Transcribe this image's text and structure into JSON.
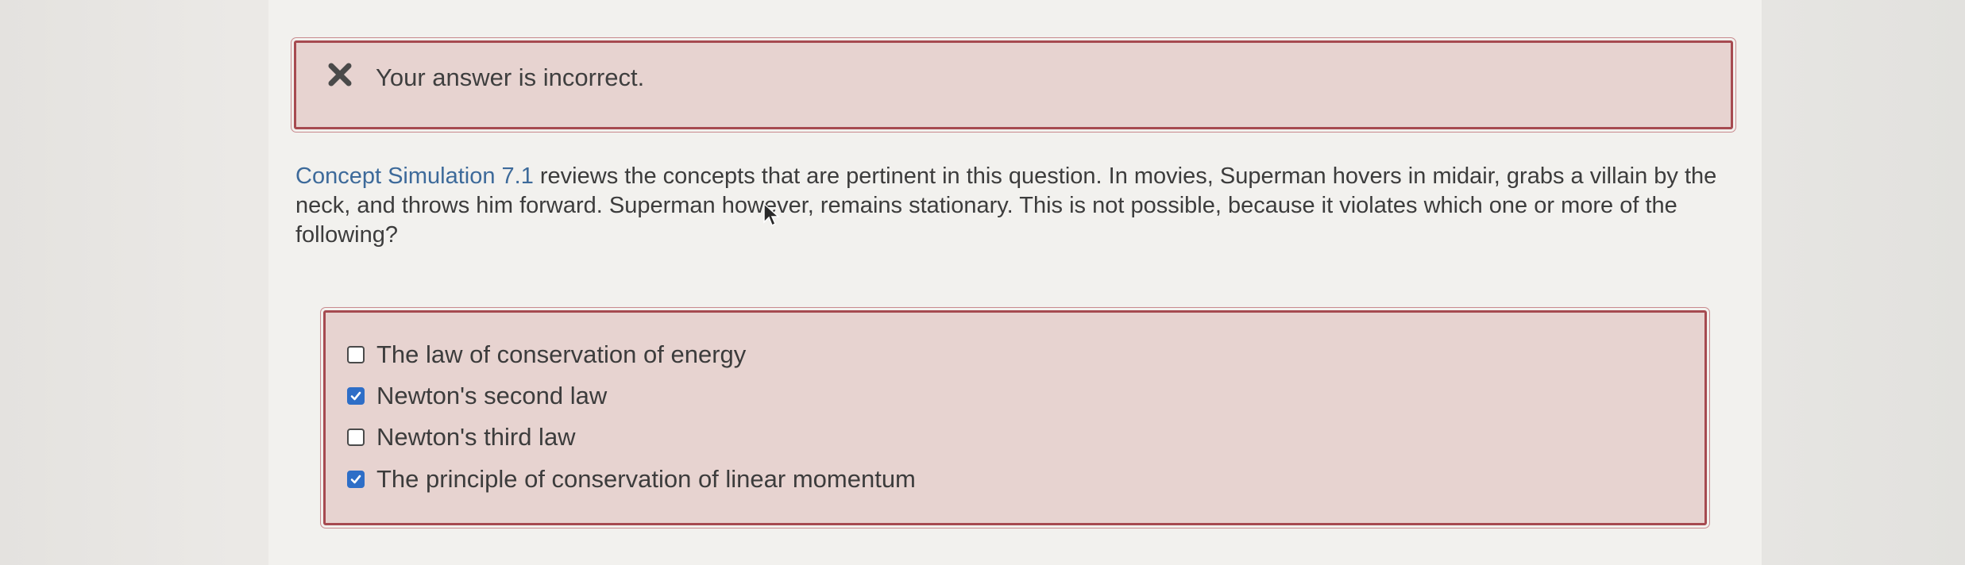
{
  "feedback": {
    "icon": "close-icon",
    "message": "Your answer is incorrect."
  },
  "question": {
    "link_text": "Concept Simulation 7.1",
    "body": " reviews the concepts that are pertinent in this question. In movies, Superman hovers in midair, grabs a villain by the neck, and throws him forward. Superman however, remains stationary. This is not possible, because it violates which one or more of the following?"
  },
  "options": [
    {
      "label": "The law of conservation of energy",
      "checked": false
    },
    {
      "label": "Newton's second law",
      "checked": true
    },
    {
      "label": "Newton's third law",
      "checked": false
    },
    {
      "label": "The principle of conservation of linear momentum",
      "checked": true
    }
  ],
  "colors": {
    "error_border": "#a64a50",
    "error_background": "#e7d3d0",
    "link": "#3d6a9a",
    "checkbox_checked": "#2e6ec7"
  }
}
